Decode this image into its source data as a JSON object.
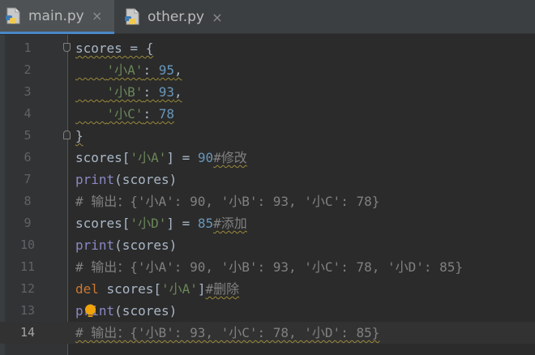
{
  "tabs": [
    {
      "label": "main.py",
      "active": true,
      "icon": "python-file-icon",
      "close": "×"
    },
    {
      "label": "other.py",
      "active": false,
      "icon": "python-file-icon",
      "close": "×"
    }
  ],
  "editor": {
    "current_line": 14,
    "lines": [
      {
        "num": "1",
        "tokens": [
          [
            "pl",
            "scores = {"
          ]
        ]
      },
      {
        "num": "2",
        "tokens": [
          [
            "pl",
            "    "
          ],
          [
            "str",
            "'小A'"
          ],
          [
            "pl",
            ": "
          ],
          [
            "num",
            "95"
          ],
          [
            "pl",
            ","
          ]
        ]
      },
      {
        "num": "3",
        "tokens": [
          [
            "pl",
            "    "
          ],
          [
            "str",
            "'小B'"
          ],
          [
            "pl",
            ": "
          ],
          [
            "num",
            "93"
          ],
          [
            "pl",
            ","
          ]
        ]
      },
      {
        "num": "4",
        "tokens": [
          [
            "pl",
            "    "
          ],
          [
            "str",
            "'小C'"
          ],
          [
            "pl",
            ": "
          ],
          [
            "num",
            "78"
          ]
        ]
      },
      {
        "num": "5",
        "tokens": [
          [
            "pl",
            "}"
          ]
        ]
      },
      {
        "num": "6",
        "tokens": [
          [
            "pl",
            "scores["
          ],
          [
            "str",
            "'小A'"
          ],
          [
            "pl",
            "] = "
          ],
          [
            "num",
            "90"
          ],
          [
            "com",
            "#修改"
          ]
        ]
      },
      {
        "num": "7",
        "tokens": [
          [
            "fn",
            "print"
          ],
          [
            "pl",
            "(scores)"
          ]
        ]
      },
      {
        "num": "8",
        "tokens": [
          [
            "com",
            "# 输出：{'小A': 90, '小B': 93, '小C': 78}"
          ]
        ]
      },
      {
        "num": "9",
        "tokens": [
          [
            "pl",
            "scores["
          ],
          [
            "str",
            "'小D'"
          ],
          [
            "pl",
            "] = "
          ],
          [
            "num",
            "85"
          ],
          [
            "com",
            "#添加"
          ]
        ]
      },
      {
        "num": "10",
        "tokens": [
          [
            "fn",
            "print"
          ],
          [
            "pl",
            "(scores)"
          ]
        ]
      },
      {
        "num": "11",
        "tokens": [
          [
            "com",
            "# 输出：{'小A': 90, '小B': 93, '小C': 78, '小D': 85}"
          ]
        ]
      },
      {
        "num": "12",
        "tokens": [
          [
            "kw",
            "del"
          ],
          [
            "pl",
            " scores["
          ],
          [
            "str",
            "'小A'"
          ],
          [
            "pl",
            "]"
          ],
          [
            "com",
            "#删除"
          ]
        ]
      },
      {
        "num": "13",
        "tokens": [
          [
            "fn",
            "print"
          ],
          [
            "pl",
            "(scores)"
          ]
        ]
      },
      {
        "num": "14",
        "tokens": [
          [
            "com",
            "# 输出：{'小B': 93, '小C': 78, '小D': 85}"
          ]
        ]
      }
    ],
    "intention_bulb": {
      "icon": "lightbulb-icon",
      "line": 13,
      "color": "#f0a30a"
    }
  },
  "colors": {
    "string": "#6a8759",
    "number": "#6897bb",
    "comment": "#808080",
    "keyword": "#cc7832",
    "builtin": "#8888c6",
    "text": "#a9b7c6",
    "tab_underline": "#4a88c7"
  }
}
